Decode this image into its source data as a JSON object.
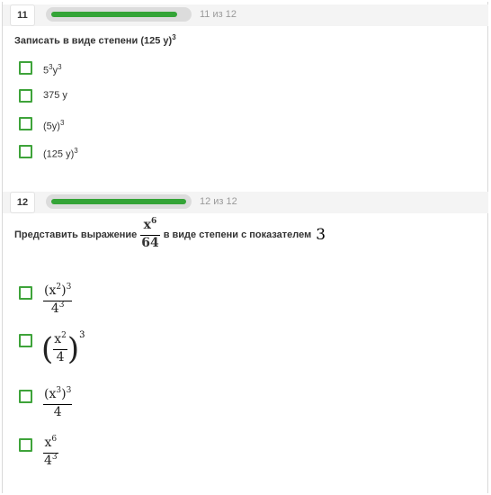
{
  "questions": [
    {
      "number": "11",
      "progress": 0.9,
      "counter": "11 из 12",
      "prompt": "Записать в виде степени (125 у)",
      "prompt_exp": "3",
      "options": [
        {
          "base": "5",
          "exp1": "3",
          "mid": "у",
          "exp2": "3"
        },
        {
          "text": "375 у"
        },
        {
          "text": "(5у)",
          "exp": "3"
        },
        {
          "text": "(125 у)",
          "exp": "3"
        }
      ]
    },
    {
      "number": "12",
      "progress": 1.0,
      "counter": "12 из 12",
      "prompt_before": "Представить выражение",
      "prompt_frac": {
        "num": "x",
        "num_exp": "6",
        "den": "64"
      },
      "prompt_after": "в виде степени с показателем",
      "prompt_power": "3",
      "options": [
        {
          "num_base": "(x",
          "num_inner_exp": "2",
          "num_close": ")",
          "num_outer_exp": "3",
          "den_base": "4",
          "den_exp": "3"
        },
        {
          "inner_num": "x",
          "inner_num_exp": "2",
          "inner_den": "4",
          "outer_exp": "3"
        },
        {
          "num_base": "(x",
          "num_inner_exp": "3",
          "num_close": ")",
          "num_outer_exp": "3",
          "den_base": "4"
        },
        {
          "num_base": "x",
          "num_exp": "6",
          "den_base": "4",
          "den_exp": "3"
        }
      ]
    }
  ],
  "icons": {
    "checkbox": "checkbox-icon"
  },
  "colors": {
    "accent": "#3ea33a",
    "progress": "#34a437",
    "header_bg": "#f4f4f4"
  }
}
